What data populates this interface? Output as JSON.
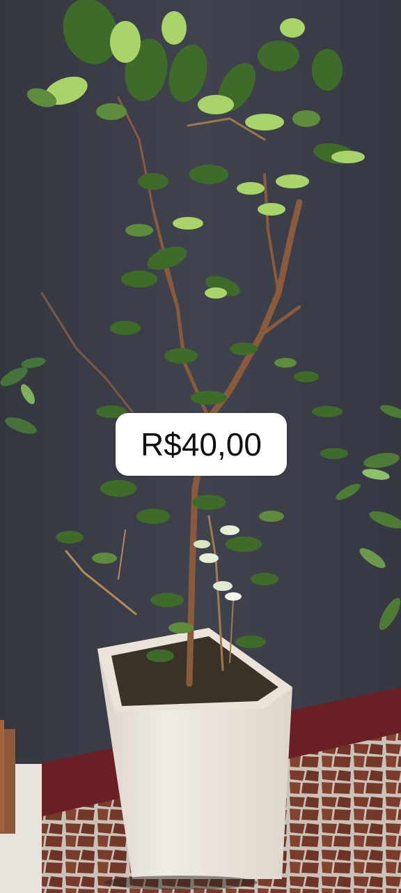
{
  "photo": {
    "subject": "potted-citrus-tree",
    "colors": {
      "wall": "#3c3f49",
      "baseboard": "#6a1f24",
      "floor_tile": "#7a3b2c",
      "grout": "#c9c2b8",
      "pot": "#ebe6de",
      "soil": "#3a3226",
      "leaf_dark": "#3f6b2a",
      "leaf_light": "#a9d46a",
      "trunk": "#8a5a3c"
    }
  },
  "price_tag": {
    "text": "R$40,00",
    "background": "#ffffff",
    "text_color": "#111111"
  }
}
